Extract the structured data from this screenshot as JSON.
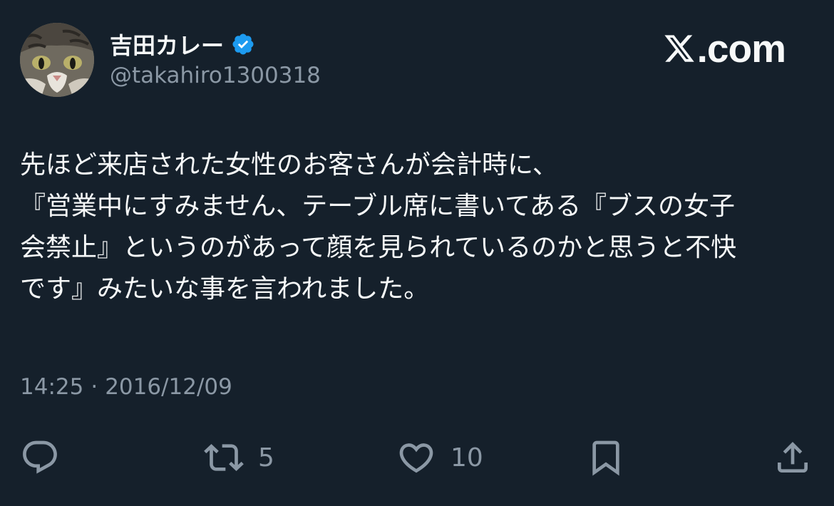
{
  "author": {
    "display_name": "吉田カレー",
    "handle": "@takahiro1300318",
    "avatar_icon": "cat-avatar-icon",
    "verified_icon": "verified-badge-icon",
    "verified_color": "#1d9bf0"
  },
  "brand": {
    "icon": "x-logo-icon",
    "text": ".com"
  },
  "tweet": {
    "lines": [
      "先ほど来店された女性のお客さんが会計時に、",
      "『営業中にすみません、テーブル席に書いてある『ブスの女子",
      "会禁止』というのがあって顔を見られているのかと思うと不快",
      "です』みたいな事を言われました。"
    ]
  },
  "meta": {
    "time": "14:25",
    "separator": "·",
    "date": "2016/12/09"
  },
  "actions": {
    "reply": {
      "icon": "reply-icon"
    },
    "retweet": {
      "icon": "retweet-icon",
      "count": "5"
    },
    "like": {
      "icon": "heart-icon",
      "count": "10"
    },
    "bookmark": {
      "icon": "bookmark-icon"
    },
    "share": {
      "icon": "share-icon"
    }
  },
  "colors": {
    "background": "#15202b",
    "text": "#f7f9f9",
    "secondary_text": "#8b98a5"
  }
}
